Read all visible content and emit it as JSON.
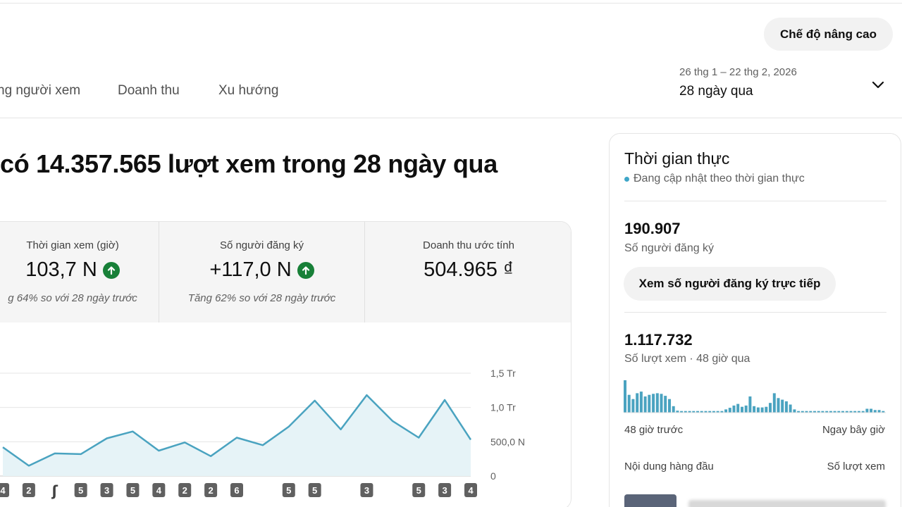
{
  "header": {
    "advanced_mode_button": "Chế độ nâng cao"
  },
  "tabs": [
    {
      "label": "ng người xem"
    },
    {
      "label": "Doanh thu"
    },
    {
      "label": "Xu hướng"
    }
  ],
  "date_range": {
    "period": "26 thg 1 – 22 thg 2, 2026",
    "label": "28 ngày qua"
  },
  "headline": "có 14.357.565 lượt xem trong 28 ngày qua",
  "stats": [
    {
      "label": "Thời gian xem (giờ)",
      "value": "103,7 N",
      "trend": "up",
      "comparison": "g 64% so với 28 ngày trước"
    },
    {
      "label": "Số người đăng ký",
      "value": "+117,0 N",
      "trend": "up",
      "comparison": "Tăng 62% so với 28 ngày trước"
    },
    {
      "label": "Doanh thu ước tính",
      "value": "504.965 ₫",
      "trend": "",
      "comparison": ""
    }
  ],
  "colors": {
    "accent_line": "#4aa3c0",
    "accent_fill": "#e6f3f7",
    "trend_up": "#188038"
  },
  "chart_data": {
    "type": "area",
    "y_tick_labels": [
      "1,5 Tr",
      "1,0 Tr",
      "500,0 N",
      "0"
    ],
    "ylim": [
      0,
      1500000
    ],
    "grid": true,
    "values": [
      420000,
      150000,
      330000,
      320000,
      550000,
      650000,
      370000,
      490000,
      290000,
      560000,
      450000,
      720000,
      1100000,
      680000,
      1180000,
      800000,
      560000,
      1110000,
      530000
    ],
    "markers": [
      "4",
      "2",
      "",
      "5",
      "3",
      "5",
      "4",
      "2",
      "2",
      "6",
      "",
      "5",
      "5",
      "",
      "3",
      "",
      "5",
      "3",
      "4"
    ]
  },
  "realtime": {
    "title": "Thời gian thực",
    "live_label": "Đang cập nhật theo thời gian thực",
    "subscribers_value": "190.907",
    "subscribers_label": "Số người đăng ký",
    "live_subs_button": "Xem số người đăng ký trực tiếp",
    "views_value": "1.117.732",
    "views_label": "Số lượt xem · 48 giờ qua",
    "hourly_views": [
      1.0,
      0.55,
      0.42,
      0.6,
      0.65,
      0.5,
      0.55,
      0.58,
      0.6,
      0.58,
      0.52,
      0.42,
      0.2,
      0.06,
      0.05,
      0.05,
      0.05,
      0.05,
      0.05,
      0.05,
      0.05,
      0.05,
      0.05,
      0.05,
      0.05,
      0.1,
      0.15,
      0.22,
      0.27,
      0.18,
      0.22,
      0.5,
      0.2,
      0.16,
      0.16,
      0.18,
      0.3,
      0.6,
      0.45,
      0.4,
      0.35,
      0.25,
      0.1,
      0.05,
      0.05,
      0.05,
      0.05,
      0.05,
      0.05,
      0.05,
      0.05,
      0.05,
      0.05,
      0.05,
      0.05,
      0.05,
      0.05,
      0.05,
      0.05,
      0.05,
      0.12,
      0.12,
      0.08,
      0.08,
      0.05
    ],
    "axis_start": "48 giờ trước",
    "axis_end": "Ngay bây giờ",
    "top_content_header": "Nội dung hàng đầu",
    "views_header": "Số lượt xem"
  }
}
